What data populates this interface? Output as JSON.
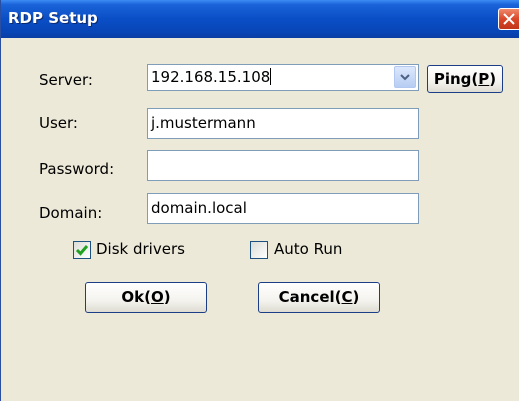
{
  "window": {
    "title": "RDP Setup"
  },
  "form": {
    "server_label": "Server:",
    "server_value": "192.168.15.108",
    "ping_text": "Ping(",
    "ping_key": "P",
    "ping_end": ")",
    "user_label": "User:",
    "user_value": "j.mustermann",
    "password_label": "Password:",
    "password_value": "",
    "domain_label": "Domain:",
    "domain_value": "domain.local"
  },
  "options": {
    "disk_drivers_label": "Disk drivers",
    "disk_drivers_checked": true,
    "auto_run_label": "Auto Run",
    "auto_run_checked": false
  },
  "buttons": {
    "ok_text": "Ok(",
    "ok_key": "O",
    "ok_end": ")",
    "cancel_text": "Cancel(",
    "cancel_key": "C",
    "cancel_end": ")"
  },
  "icons": {
    "close": "close-icon",
    "dropdown": "chevron-down-icon",
    "check": "checkmark-icon"
  }
}
